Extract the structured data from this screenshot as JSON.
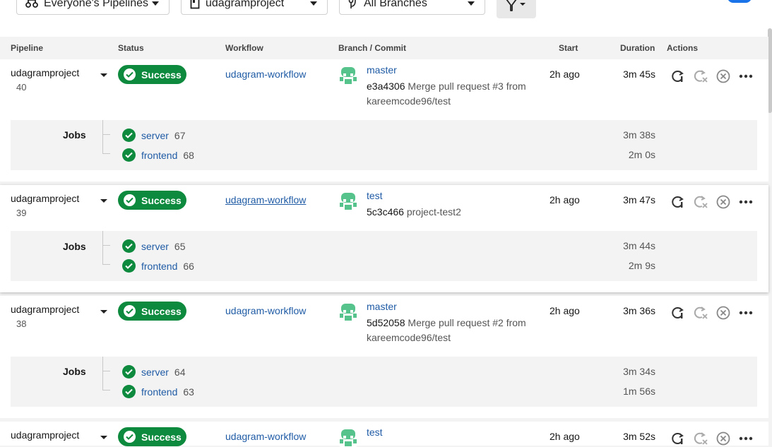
{
  "toolbar": {
    "pipelines_filter": "Everyone's Pipelines",
    "project_filter": "udagramproject",
    "branch_filter": "All Branches"
  },
  "columns": {
    "pipeline": "Pipeline",
    "status": "Status",
    "workflow": "Workflow",
    "branch_commit": "Branch / Commit",
    "start": "Start",
    "duration": "Duration",
    "actions": "Actions"
  },
  "jobs_label": "Jobs",
  "rows": [
    {
      "name": "udagramproject",
      "number": "40",
      "status": "Success",
      "workflow": "udagram-workflow",
      "branch": "master",
      "commit_hash": "e3a4306",
      "commit_msg": "Merge pull request #3 from kareemcode96/test",
      "start": "2h ago",
      "duration": "3m 45s",
      "jobs": [
        {
          "name": "server",
          "number": "67",
          "duration": "3m 38s"
        },
        {
          "name": "frontend",
          "number": "68",
          "duration": "2m 0s"
        }
      ]
    },
    {
      "name": "udagramproject",
      "number": "39",
      "status": "Success",
      "workflow": "udagram-workflow",
      "branch": "test",
      "commit_hash": "5c3c466",
      "commit_msg": "project-test2",
      "start": "2h ago",
      "duration": "3m 47s",
      "jobs": [
        {
          "name": "server",
          "number": "65",
          "duration": "3m 44s"
        },
        {
          "name": "frontend",
          "number": "66",
          "duration": "2m 9s"
        }
      ]
    },
    {
      "name": "udagramproject",
      "number": "38",
      "status": "Success",
      "workflow": "udagram-workflow",
      "branch": "master",
      "commit_hash": "5d52058",
      "commit_msg": "Merge pull request #2 from kareemcode96/test",
      "start": "2h ago",
      "duration": "3m 36s",
      "jobs": [
        {
          "name": "server",
          "number": "64",
          "duration": "3m 34s"
        },
        {
          "name": "frontend",
          "number": "63",
          "duration": "1m 56s"
        }
      ]
    },
    {
      "name": "udagramproject",
      "status": "Success",
      "workflow": "udagram-workflow",
      "branch": "test",
      "start": "2h ago",
      "duration": "3m 52s"
    }
  ],
  "icons": {
    "rerun": "rerun-icon",
    "rerun_failed": "rerun-failed-icon",
    "cancel": "cancel-icon",
    "more": "more-icon"
  },
  "colors": {
    "success": "#0e8a3e",
    "link": "#1f5ba5"
  }
}
